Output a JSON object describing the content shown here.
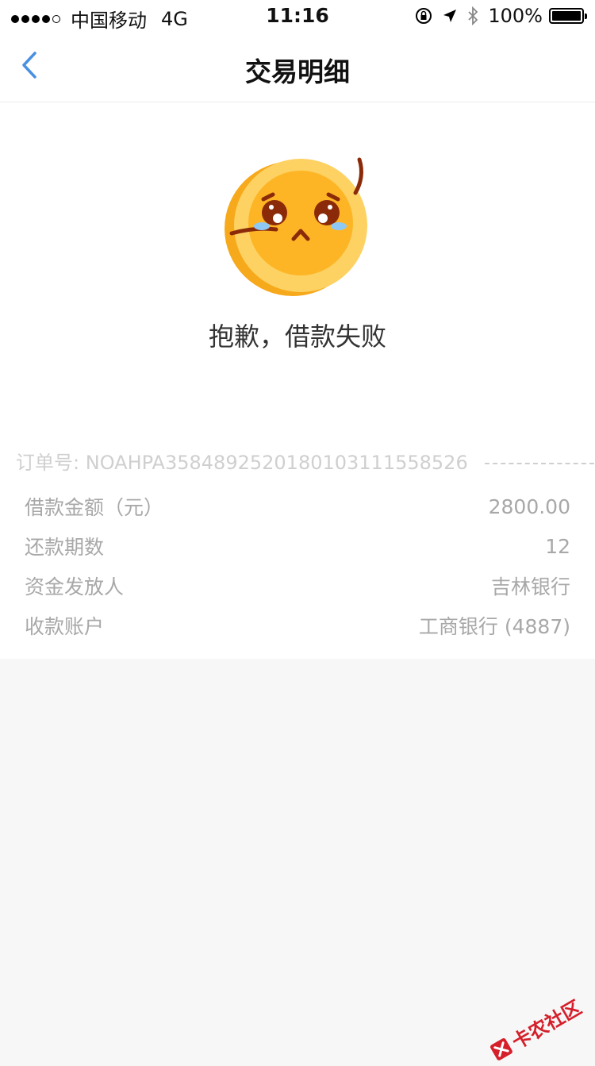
{
  "status_bar": {
    "carrier": "中国移动",
    "network": "4G",
    "time": "11:16",
    "battery": "100%",
    "battery_level": 1.0
  },
  "header": {
    "title": "交易明细",
    "back_icon": "chevron-left-icon"
  },
  "result": {
    "illustration": "crying-coin-icon",
    "message": "抱歉，借款失败"
  },
  "order": {
    "label": "订单号:",
    "number": "NOAHPA35848925201801031115 58526"
  },
  "details": [
    {
      "label": "借款金额（元）",
      "value": "2800.00"
    },
    {
      "label": "还款期数",
      "value": "12"
    },
    {
      "label": "资金发放人",
      "value": "吉林银行"
    },
    {
      "label": "收款账户",
      "value": "工商银行 (4887)"
    }
  ],
  "watermark": {
    "text": "卡农社区"
  },
  "colors": {
    "accent": "#4a90e2",
    "coin_outer": "#f7a91c",
    "coin_rim": "#fdd262",
    "coin_face": "#fdb526",
    "muted_text": "#a8a8a8",
    "watermark": "#d51f2a"
  }
}
